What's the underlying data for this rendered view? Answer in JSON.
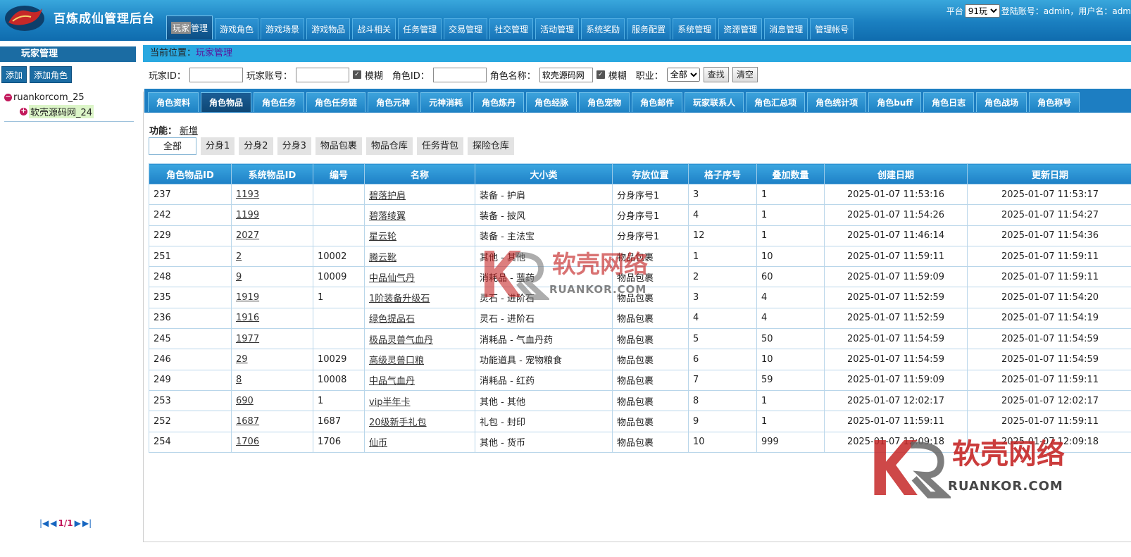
{
  "header": {
    "title": "百炼成仙管理后台",
    "nav": [
      "玩家管理",
      "游戏角色",
      "游戏场景",
      "游戏物品",
      "战斗相关",
      "任务管理",
      "交易管理",
      "社交管理",
      "活动管理",
      "系统奖励",
      "服务配置",
      "系统管理",
      "资源管理",
      "消息管理",
      "管理帐号"
    ],
    "nav_active_prefix": "玩家",
    "nav_active_suffix": "管理",
    "platform_label": "平台",
    "platform_value": "91玩",
    "login_info": "登陆账号：admin，用户名：adm"
  },
  "sidebar": {
    "title": "玩家管理",
    "add_label": "添加",
    "add_role_label": "添加角色",
    "tree_root": "ruankorcom_25",
    "tree_child": "软壳源码网_24",
    "pager": "1/1"
  },
  "breadcrumb": {
    "label": "当前位置：",
    "link": "玩家管理"
  },
  "search": {
    "player_id_label": "玩家ID：",
    "player_id_value": "",
    "account_label": "玩家账号：",
    "account_value": "",
    "fuzzy_label": "模糊",
    "role_id_label": "角色ID：",
    "role_id_value": "",
    "role_name_label": "角色名称：",
    "role_name_value": "软壳源码网",
    "fuzzy2_label": "模糊",
    "job_label": "职业：",
    "job_value": "全部",
    "search_btn": "查找",
    "clear_btn": "清空"
  },
  "tabs": [
    "角色资料",
    "角色物品",
    "角色任务",
    "角色任务链",
    "角色元神",
    "元神消耗",
    "角色炼丹",
    "角色经脉",
    "角色宠物",
    "角色邮件",
    "玩家联系人",
    "角色汇总项",
    "角色统计项",
    "角色buff",
    "角色日志",
    "角色战场",
    "角色称号"
  ],
  "active_tab": "角色物品",
  "func": {
    "label": "功能：",
    "add": "新增"
  },
  "filters": [
    "全部",
    "分身1",
    "分身2",
    "分身3",
    "物品包裹",
    "物品仓库",
    "任务背包",
    "探险仓库"
  ],
  "table": {
    "headers": [
      "角色物品ID",
      "系统物品ID",
      "编号",
      "名称",
      "大小类",
      "存放位置",
      "格子序号",
      "叠加数量",
      "创建日期",
      "更新日期"
    ],
    "rows": [
      [
        "237",
        "1193",
        "",
        "碧落护肩",
        "装备 - 护肩",
        "分身序号1",
        "3",
        "1",
        "2025-01-07 11:53:16",
        "2025-01-07 11:53:17"
      ],
      [
        "242",
        "1199",
        "",
        "碧落绫翼",
        "装备 - 披风",
        "分身序号1",
        "4",
        "1",
        "2025-01-07 11:54:26",
        "2025-01-07 11:54:27"
      ],
      [
        "229",
        "2027",
        "",
        "星云轮",
        "装备 - 主法宝",
        "分身序号1",
        "12",
        "1",
        "2025-01-07 11:46:14",
        "2025-01-07 11:54:36"
      ],
      [
        "251",
        "2",
        "10002",
        "腾云靴",
        "其他 - 其他",
        "物品包裹",
        "1",
        "10",
        "2025-01-07 11:59:11",
        "2025-01-07 11:59:11"
      ],
      [
        "248",
        "9",
        "10009",
        "中品仙气丹",
        "消耗品 - 蓝药",
        "物品包裹",
        "2",
        "60",
        "2025-01-07 11:59:09",
        "2025-01-07 11:59:11"
      ],
      [
        "235",
        "1919",
        "1",
        "1阶装备升级石",
        "灵石 - 进阶石",
        "物品包裹",
        "3",
        "4",
        "2025-01-07 11:52:59",
        "2025-01-07 11:54:20"
      ],
      [
        "236",
        "1916",
        "",
        "绿色提品石",
        "灵石 - 进阶石",
        "物品包裹",
        "4",
        "4",
        "2025-01-07 11:52:59",
        "2025-01-07 11:54:19"
      ],
      [
        "245",
        "1977",
        "",
        "极品灵兽气血丹",
        "消耗品 - 气血丹药",
        "物品包裹",
        "5",
        "50",
        "2025-01-07 11:54:59",
        "2025-01-07 11:54:59"
      ],
      [
        "246",
        "29",
        "10029",
        "高级灵兽口粮",
        "功能道具 - 宠物粮食",
        "物品包裹",
        "6",
        "10",
        "2025-01-07 11:54:59",
        "2025-01-07 11:54:59"
      ],
      [
        "249",
        "8",
        "10008",
        "中品气血丹",
        "消耗品 - 红药",
        "物品包裹",
        "7",
        "59",
        "2025-01-07 11:59:09",
        "2025-01-07 11:59:11"
      ],
      [
        "253",
        "690",
        "1",
        "vip半年卡",
        "其他 - 其他",
        "物品包裹",
        "8",
        "1",
        "2025-01-07 12:02:17",
        "2025-01-07 12:02:17"
      ],
      [
        "252",
        "1687",
        "1687",
        "20级新手礼包",
        "礼包 - 封印",
        "物品包裹",
        "9",
        "1",
        "2025-01-07 11:59:11",
        "2025-01-07 11:59:11"
      ],
      [
        "254",
        "1706",
        "1706",
        "仙币",
        "其他 - 货币",
        "物品包裹",
        "10",
        "999",
        "2025-01-07 12:09:18",
        "2025-01-07 12:09:18"
      ]
    ]
  },
  "watermark": {
    "cn": "软壳网络",
    "en": "RUANKOR.COM"
  },
  "colors": {
    "header": "#1a7fc0",
    "accent": "#1d7ec2",
    "dark": "#1b6ca3",
    "watermark": "#c62828"
  }
}
